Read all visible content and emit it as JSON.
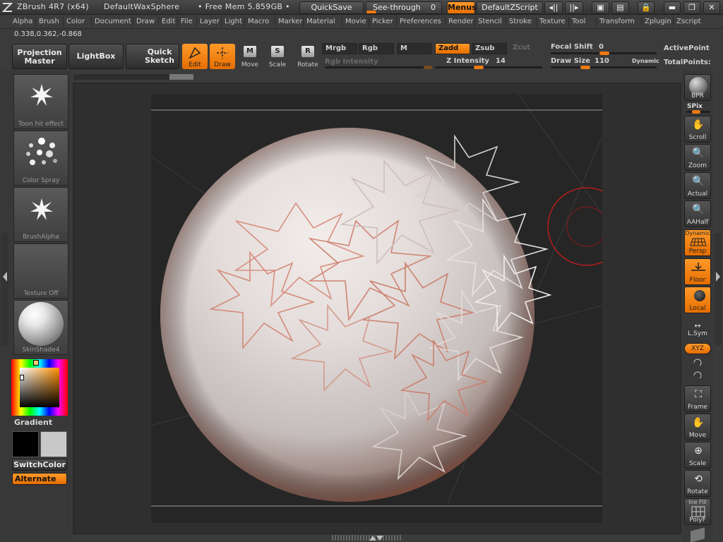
{
  "title": {
    "app_name": "ZBrush 4R7 (x64)",
    "document": "DefaultWaxSphere",
    "memory": "• Free Mem 5.859GB •",
    "quicksave": "QuickSave",
    "see_through_label": "See-through",
    "see_through_value": "0",
    "menus_button": "Menus",
    "zscript_button": "DefaultZScript"
  },
  "menubar": [
    "Alpha",
    "Brush",
    "Color",
    "Document",
    "Draw",
    "Edit",
    "File",
    "Layer",
    "Light",
    "Macro",
    "Marker",
    "Material",
    "Movie",
    "Picker",
    "Preferences",
    "Render",
    "Stencil",
    "Stroke",
    "Texture",
    "Tool",
    "Transform",
    "Zplugin",
    "Zscript"
  ],
  "coords": "0.338,0.362,-0.868",
  "shelf": {
    "projection_master": [
      "Projection",
      "Master"
    ],
    "lightbox": "LightBox",
    "quick_sketch": [
      "Quick",
      "Sketch"
    ],
    "edit": "Edit",
    "draw": "Draw",
    "move": "Move",
    "scale": "Scale",
    "rotate": "Rotate"
  },
  "draw_options": {
    "mrgb": "Mrgb",
    "rgb": "Rgb",
    "m": "M",
    "rgb_intensity": "Rgb Intensity",
    "zadd": "Zadd",
    "zsub": "Zsub",
    "zcut": "Zcut",
    "z_intensity_label": "Z Intensity",
    "z_intensity_value": "14",
    "focal_shift_label": "Focal Shift",
    "focal_shift_value": "0",
    "draw_size_label": "Draw Size",
    "draw_size_value": "110",
    "dynamic": "Dynamic",
    "active_points": "ActivePoint",
    "total_points": "TotalPoints:"
  },
  "left_panel": {
    "stroke": "Toon hit effect",
    "alpha_spray": "Color Spray",
    "brush_alpha": "BrushAlpha",
    "texture": "Texture Off",
    "material": "SkinShade4",
    "gradient": "Gradient",
    "switch_color": "SwitchColor",
    "alternate": "Alternate"
  },
  "right_panel": {
    "bpr": "BPR",
    "spix": "SPix",
    "scroll": "Scroll",
    "zoom": "Zoom",
    "actual": "Actual",
    "aahalf": "AAHalf",
    "dynamic": "Dynamic",
    "persp": "Persp",
    "floor": "Floor",
    "local": "Local",
    "lsym": "L.Sym",
    "xyz": "XYZ",
    "frame": "Frame",
    "move": "Move",
    "scale": "Scale",
    "rotate": "Rotate",
    "line_fill": "Ine Fill",
    "polyf": "PolyF"
  },
  "colors": {
    "accent": "#f07a10",
    "primary_color": "#000000",
    "secondary_color": "#c8c8c8",
    "cursor": "#cc1a1a"
  }
}
